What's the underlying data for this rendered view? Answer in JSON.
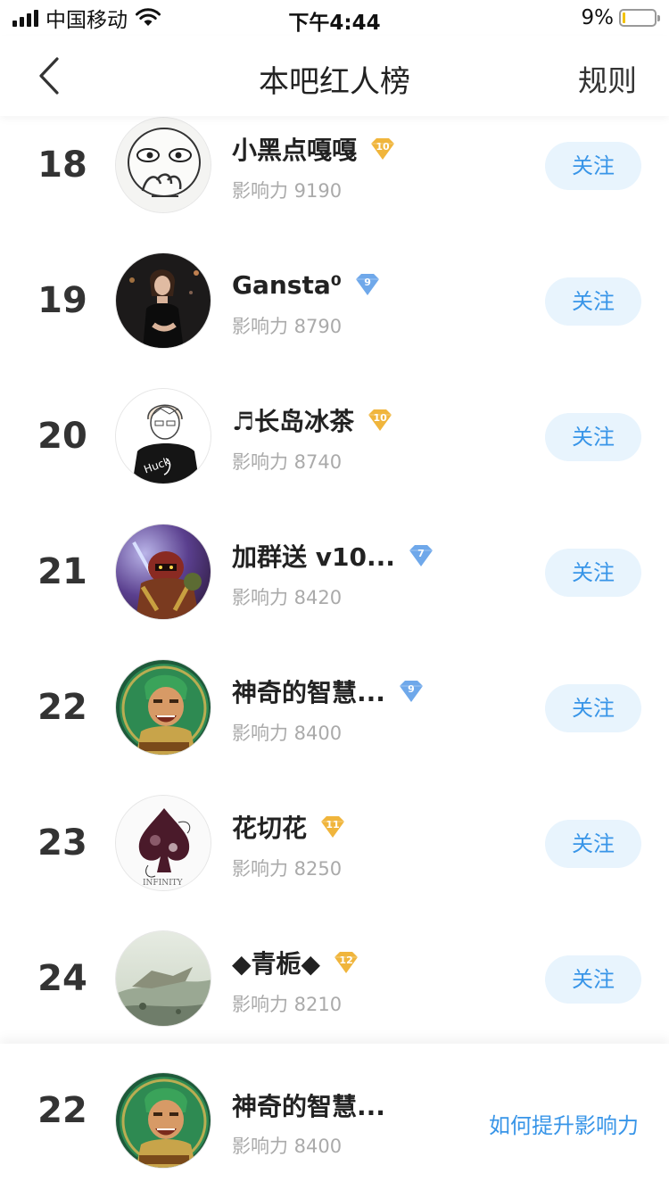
{
  "status_bar": {
    "carrier": "中国移动",
    "time": "下午4:44",
    "battery_percent": "9%",
    "battery_level": 0.09,
    "icons": [
      "signal-icon",
      "wifi-icon",
      "battery-icon"
    ]
  },
  "nav": {
    "back_icon": "chevron-left-icon",
    "title": "本吧红人榜",
    "rule_label": "规则"
  },
  "colors": {
    "accent": "#3895e8",
    "follow_bg": "#e8f4fd",
    "badge_gold": "#f0b53c",
    "badge_blue": "#6fa8ea"
  },
  "rankings": [
    {
      "rank": "18",
      "name": "小黑点嘎嘎",
      "level": "10",
      "badge": "gold",
      "influence": "影响力 9190",
      "follow_label": "关注",
      "avatar": "meme-face"
    },
    {
      "rank": "19",
      "name": "Gansta⁰",
      "level": "9",
      "badge": "blue",
      "influence": "影响力 8790",
      "follow_label": "关注",
      "avatar": "woman-dark"
    },
    {
      "rank": "20",
      "name": "♬长岛冰茶",
      "level": "10",
      "badge": "gold",
      "influence": "影响力 8740",
      "follow_label": "关注",
      "avatar": "sketch-boy"
    },
    {
      "rank": "21",
      "name": "加群送 v10...",
      "level": "7",
      "badge": "blue",
      "influence": "影响力 8420",
      "follow_label": "关注",
      "avatar": "warrior-purple"
    },
    {
      "rank": "22",
      "name": "神奇的智慧...",
      "level": "9",
      "badge": "blue",
      "influence": "影响力 8400",
      "follow_label": "关注",
      "avatar": "green-hero"
    },
    {
      "rank": "23",
      "name": "花切花",
      "level": "11",
      "badge": "gold",
      "influence": "影响力 8250",
      "follow_label": "关注",
      "avatar": "spade-card"
    },
    {
      "rank": "24",
      "name": "◆青栀◆",
      "level": "12",
      "badge": "gold",
      "influence": "影响力 8210",
      "follow_label": "关注",
      "avatar": "landscape"
    }
  ],
  "my_rank": {
    "rank": "22",
    "name": "神奇的智慧...",
    "influence": "影响力 8400",
    "avatar": "green-hero",
    "link_label": "如何提升影响力"
  }
}
